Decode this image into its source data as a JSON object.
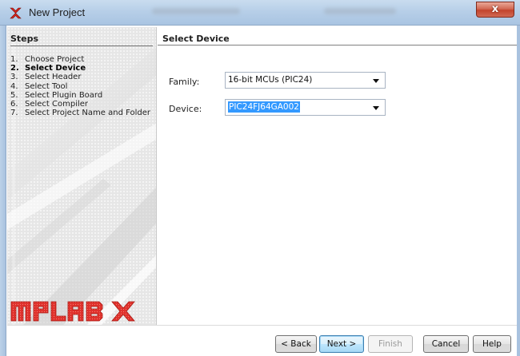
{
  "window": {
    "title": "New Project",
    "close_glyph": "x",
    "icon": "mplab-x-icon"
  },
  "steps": {
    "heading": "Steps",
    "items": [
      {
        "num": "1.",
        "label": "Choose Project"
      },
      {
        "num": "2.",
        "label": "Select Device"
      },
      {
        "num": "3.",
        "label": "Select Header"
      },
      {
        "num": "4.",
        "label": "Select Tool"
      },
      {
        "num": "5.",
        "label": "Select Plugin Board"
      },
      {
        "num": "6.",
        "label": "Select Compiler"
      },
      {
        "num": "7.",
        "label": "Select Project Name and Folder"
      }
    ],
    "current_index": 1,
    "logo_text": "MPLAB X"
  },
  "main": {
    "heading": "Select Device",
    "family": {
      "label": "Family:",
      "value": "16-bit MCUs (PIC24)"
    },
    "device": {
      "label": "Device:",
      "value": "PIC24FJ64GA002"
    }
  },
  "buttons": {
    "back": "< Back",
    "next": "Next >",
    "finish": "Finish",
    "cancel": "Cancel",
    "help": "Help"
  },
  "colors": {
    "accent_selection": "#3399ff",
    "close_button": "#c3442c",
    "logo_red": "#e0312c"
  }
}
